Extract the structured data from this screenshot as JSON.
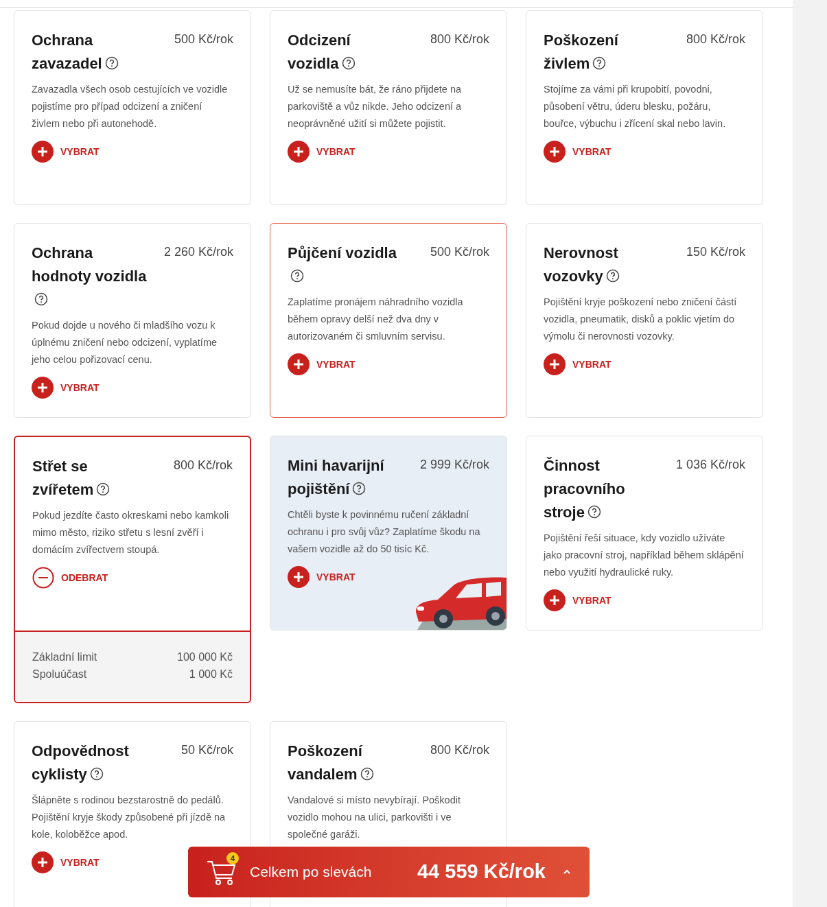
{
  "cards": [
    {
      "title": "Ochrana zavazadel",
      "price": "500 Kč/rok",
      "description": "Zavazadla všech osob cestujících ve vozidle pojistíme pro případ odcizení a zničení živlem nebo při autonehodě.",
      "action": "VYBRAT",
      "selected": false,
      "focused": false,
      "kind": "standard"
    },
    {
      "title": "Odcizení vozidla",
      "price": "800 Kč/rok",
      "description": "Už se nemusíte bát, že ráno přijdete na parkoviště a vůz nikde. Jeho odcizení a neoprávněné užití si můžete pojistit.",
      "action": "VYBRAT",
      "selected": false,
      "focused": false,
      "kind": "standard"
    },
    {
      "title": "Poškození živlem",
      "price": "800 Kč/rok",
      "description": "Stojíme za vámi při krupobití, povodni, působení větru, úderu blesku, požáru, bouřce, výbuchu i zřícení skal nebo lavin.",
      "action": "VYBRAT",
      "selected": false,
      "focused": false,
      "kind": "standard"
    },
    {
      "title": "Ochrana hodnoty vozidla",
      "price": "2 260 Kč/rok",
      "description": "Pokud dojde u nového či mladšího vozu k úplnému zničení nebo odcizení, vyplatíme jeho celou pořizovací cenu.",
      "action": "VYBRAT",
      "selected": false,
      "focused": false,
      "kind": "standard"
    },
    {
      "title": "Půjčení vozidla",
      "price": "500 Kč/rok",
      "description": "Zaplatíme pronájem náhradního vozidla během opravy delší než dva dny v autorizovaném či smluvním servisu.",
      "action": "VYBRAT",
      "selected": false,
      "focused": true,
      "kind": "standard"
    },
    {
      "title": "Nerovnost vozovky",
      "price": "150 Kč/rok",
      "description": "Pojištění kryje poškození nebo zničení částí vozidla, pneumatik, disků a poklic vjetím do výmolu či nerovnosti vozovky.",
      "action": "VYBRAT",
      "selected": false,
      "focused": false,
      "kind": "standard"
    },
    {
      "title": "Střet se zvířetem",
      "price": "800 Kč/rok",
      "description": "Pokud jezdíte často okreskami nebo kamkoli mimo město, riziko střetu s lesní zvěří i domácím zvířectvem stoupá.",
      "action": "ODEBRAT",
      "selected": true,
      "focused": false,
      "kind": "standard",
      "limits": [
        {
          "label": "Základní limit",
          "value": "100 000 Kč"
        },
        {
          "label": "Spoluúčast",
          "value": "1 000 Kč"
        }
      ]
    },
    {
      "title": "Mini havarijní pojištění",
      "price": "2 999 Kč/rok",
      "description": "Chtěli byste k povinnému ručení základní ochranu i pro svůj vůz? Zaplatíme škodu na vašem vozidle až do 50 tisíc Kč.",
      "action": "VYBRAT",
      "selected": false,
      "focused": false,
      "kind": "promo"
    },
    {
      "title": "Činnost pracovního stroje",
      "price": "1 036 Kč/rok",
      "description": "Pojištění řeší situace, kdy vozidlo užíváte jako pracovní stroj, například během sklápění nebo využití hydraulické ruky.",
      "action": "VYBRAT",
      "selected": false,
      "focused": false,
      "kind": "standard"
    },
    {
      "title": "Odpovědnost cyklisty",
      "price": "50 Kč/rok",
      "description": "Šlápněte s rodinou bezstarostně do pedálů. Pojištění kryje škody způsobené při jízdě na kole, koloběžce apod.",
      "action": "VYBRAT",
      "selected": false,
      "focused": false,
      "kind": "standard"
    },
    {
      "title": "Poškození vandalem",
      "price": "800 Kč/rok",
      "description": "Vandalové si místo nevybírají. Poškodit vozidlo mohou na ulici, parkovišti i ve společné garáži.",
      "selected": false,
      "focused": false,
      "kind": "standard"
    }
  ],
  "cart": {
    "badge": "4",
    "label": "Celkem po slevách",
    "total": "44 559 Kč/rok"
  }
}
